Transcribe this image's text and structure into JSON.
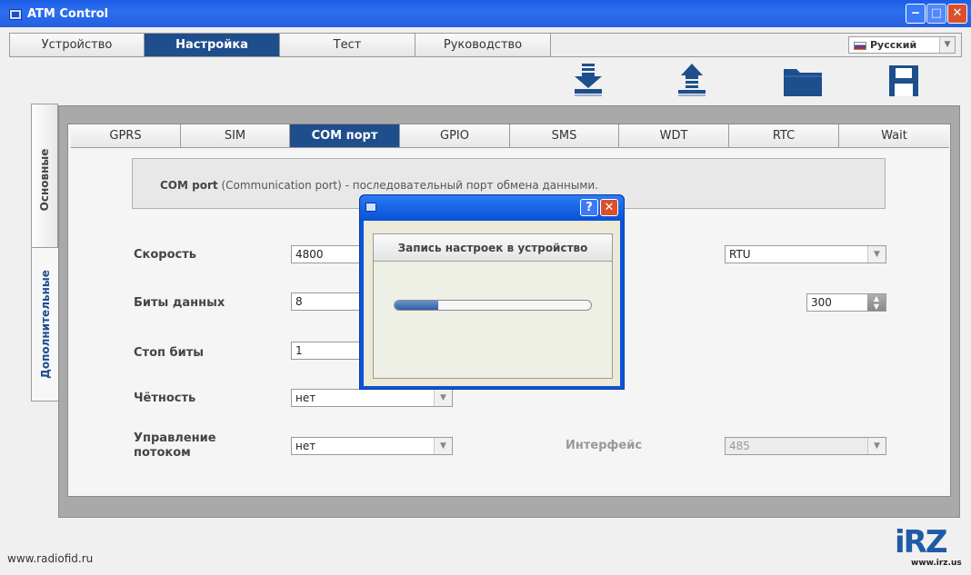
{
  "window": {
    "title": "ATM Control"
  },
  "menu": {
    "tabs": [
      {
        "label": "Устройство"
      },
      {
        "label": "Настройка"
      },
      {
        "label": "Тест"
      },
      {
        "label": "Руководство"
      }
    ],
    "active_tab": "Настройка",
    "language": "Русский"
  },
  "side_tabs": [
    {
      "label": "Основные"
    },
    {
      "label": "Дополнительные"
    }
  ],
  "sub_tabs": [
    {
      "label": "GPRS"
    },
    {
      "label": "SIM"
    },
    {
      "label": "COM порт"
    },
    {
      "label": "GPIO"
    },
    {
      "label": "SMS"
    },
    {
      "label": "WDT"
    },
    {
      "label": "RTC"
    },
    {
      "label": "Wait"
    }
  ],
  "info": {
    "bold": "COM port",
    "text": " (Communication port) - последовательный порт обмена данными."
  },
  "fields": {
    "speed": {
      "label": "Скорость",
      "value": "4800"
    },
    "data_bits": {
      "label": "Биты данных",
      "value": "8"
    },
    "stop_bits": {
      "label": "Стоп биты",
      "value": "1"
    },
    "parity": {
      "label": "Чётность",
      "value": "нет"
    },
    "flow_control": {
      "label_line1": "Управление",
      "label_line2": "потоком",
      "value": "нет"
    },
    "mode": {
      "value": "RTU"
    },
    "timeout": {
      "label_fragment": ":",
      "value": "300"
    },
    "interface": {
      "label": "Интерфейс",
      "value": "485"
    }
  },
  "dialog": {
    "heading": "Запись настроек в устройство",
    "progress_fraction": 0.22,
    "help_label": "?",
    "close_label": "✕"
  },
  "footer": {
    "url": "www.radiofid.ru",
    "logo_text": "iRZ",
    "logo_url": "www.irz.us"
  },
  "colors": {
    "accent": "#1e4e8c",
    "titlebar": "#2d6ff0",
    "close": "#d9502a"
  },
  "icons": [
    "download-icon",
    "upload-icon",
    "folder-icon",
    "save-icon"
  ]
}
